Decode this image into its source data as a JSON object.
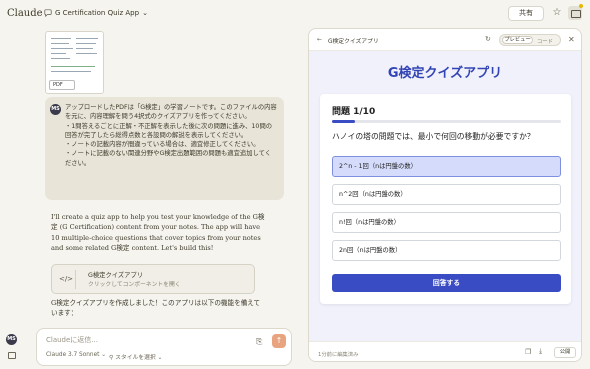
{
  "app": {
    "brand": "Claude",
    "chat_title": "G Certification Quiz App",
    "share_label": "共有"
  },
  "thumbnail": {
    "file_type": "PDF"
  },
  "user_message": {
    "avatar": "MS",
    "paragraphs": [
      "アップロードしたPDFは「G検定」の学習ノートです。このファイルの内容を元に、内容理解を問う4択式のクイズアプリを作ってください。",
      "・1問答えるごとに正解・不正解を表示した後に次の問題に進み、10問の回答が完了したら総得点数と各設問の解説を表示してください。",
      "・ノートの記載内容が間違っている場合は、適宜修正してください。",
      "・ノートに記載のない関連分野やG検定出題範囲の問題も適宜追加してください。"
    ]
  },
  "assistant_message": {
    "intro": "I'll create a quiz app to help you test your knowledge of the G検定 (G Certification) content from your notes. The app will have 10 multiple-choice questions that cover topics from your notes and some related G検定 content. Let's build this!",
    "artifact_card": {
      "name": "G検定クイズアプリ",
      "subtitle": "クリックしてコンポーネントを開く",
      "icon": "code-icon"
    },
    "outro": "G検定クイズアプリを作成しました！このアプリは以下の機能を備えています："
  },
  "composer": {
    "placeholder": "Claudeに返信...",
    "model": "Claude 3.7 Sonnet",
    "style": "スタイルを選択"
  },
  "sidebar": {
    "avatar": "MS"
  },
  "artifact": {
    "title": "G検定クイズアプリ",
    "toggle": {
      "preview": "プレビュー",
      "code": "コード"
    },
    "app_heading": "G検定クイズアプリ",
    "quiz": {
      "counter": "問題 1/10",
      "progress_fraction": 0.1,
      "question": "ハノイの塔の問題では、最小で何回の移動が必要ですか？",
      "options": [
        "2^n - 1回（nは円盤の数）",
        "n^2回（nは円盤の数）",
        "n!回（nは円盤の数）",
        "2n回（nは円盤の数）"
      ],
      "selected_index": 0,
      "submit_label": "回答する"
    },
    "footer": {
      "edited": "1分前に編集済み",
      "publish": "公開"
    }
  },
  "colors": {
    "accent": "#3a4cc4",
    "selected_option": "#d5dcfb",
    "send_button": "#e8a47f"
  }
}
